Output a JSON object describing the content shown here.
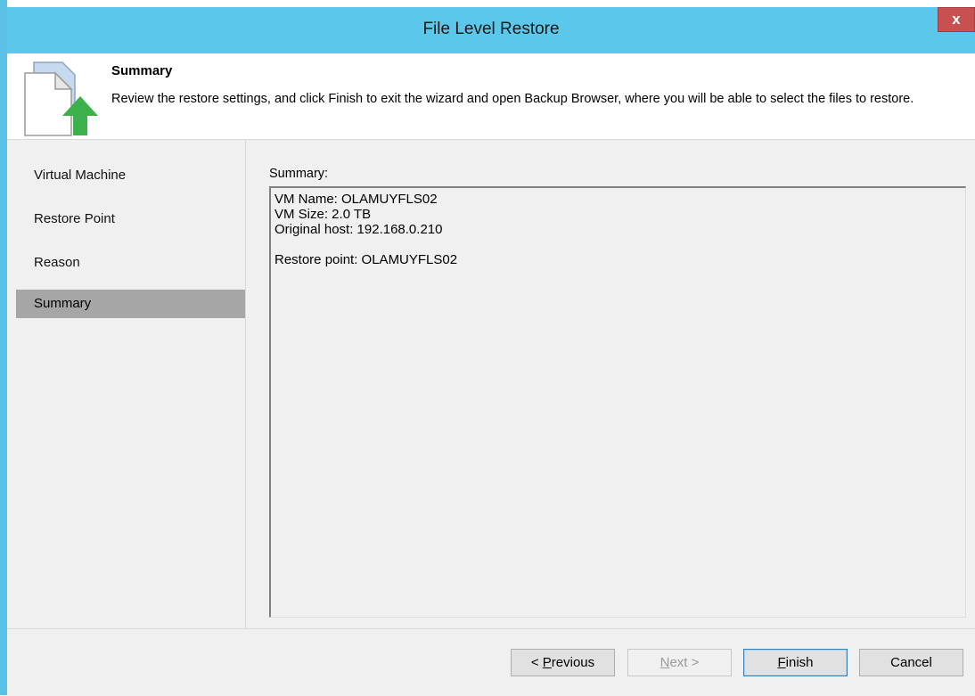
{
  "window": {
    "title": "File Level Restore",
    "close_label": "x"
  },
  "header": {
    "title": "Summary",
    "description": "Review the restore settings, and click Finish to exit the wizard and open Backup Browser, where you will be able to select the files to restore.",
    "icon": "restore-file-icon"
  },
  "steps": [
    {
      "label": "Virtual Machine",
      "active": false
    },
    {
      "label": "Restore Point",
      "active": false
    },
    {
      "label": "Reason",
      "active": false
    },
    {
      "label": "Summary",
      "active": true
    }
  ],
  "summary": {
    "label": "Summary:",
    "lines": [
      "VM Name: OLAMUYFLS02",
      "VM Size: 2.0 TB",
      "Original host: 192.168.0.210",
      "",
      "Restore point: OLAMUYFLS02"
    ]
  },
  "buttons": {
    "previous": {
      "mnemonic": "P",
      "prefix": "< ",
      "rest": "revious"
    },
    "next": {
      "mnemonic": "N",
      "prefix": "",
      "rest": "ext >"
    },
    "finish": {
      "mnemonic": "F",
      "prefix": "",
      "rest": "inish"
    },
    "cancel": "Cancel"
  },
  "colors": {
    "titlebar": "#5bc8eb",
    "accent_border": "#5bc1e6",
    "close_button": "#c75050",
    "active_step": "#a6a6a6",
    "arrow_green": "#3cb04a"
  }
}
